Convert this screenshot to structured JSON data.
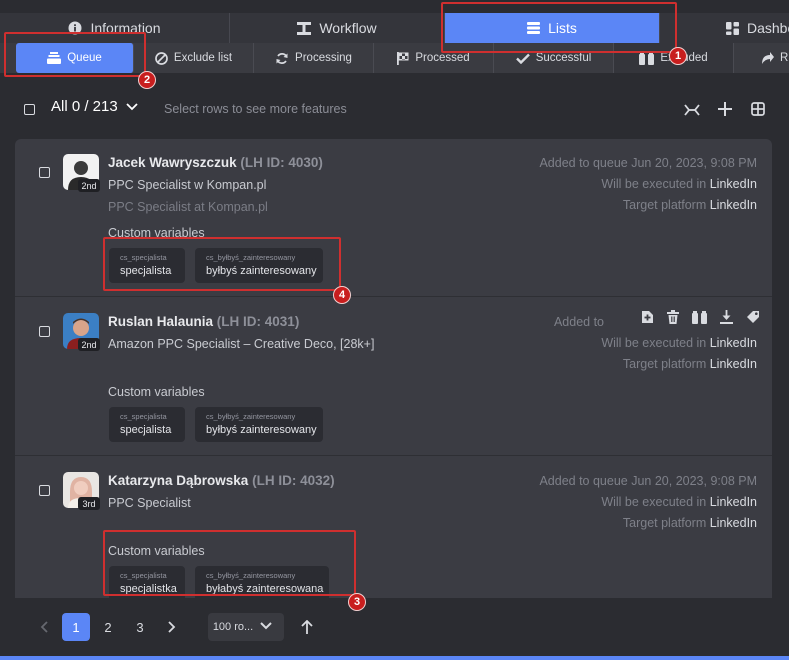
{
  "top_tabs": [
    {
      "label": "Information",
      "icon": "info-icon"
    },
    {
      "label": "Workflow",
      "icon": "workflow-icon"
    },
    {
      "label": "Lists",
      "icon": "list-icon",
      "active": true
    },
    {
      "label": "Dashbo",
      "icon": "dashboard-icon"
    }
  ],
  "sub_tabs": [
    {
      "label": "Queue",
      "icon": "queue-icon",
      "active": true
    },
    {
      "label": "Exclude list",
      "icon": "block-icon"
    },
    {
      "label": "Processing",
      "icon": "sync-icon"
    },
    {
      "label": "Processed",
      "icon": "flag-icon"
    },
    {
      "label": "Successful",
      "icon": "check-icon"
    },
    {
      "label": "Excluded",
      "icon": "exclude-icon"
    },
    {
      "label": "R",
      "icon": "reply-icon"
    }
  ],
  "toolbar": {
    "selection_label": "All 0 / 213",
    "hint": "Select rows to see more features"
  },
  "rows": [
    {
      "name": "Jacek Wawryszczuk",
      "lh_id": "(LH ID: 4030)",
      "degree": "2nd",
      "headline": "PPC Specialist w Kompan.pl",
      "company": "PPC Specialist at Kompan.pl",
      "added": "Added to queue Jun 20, 2023, 9:08 PM",
      "executed_prefix": "Will be executed in",
      "executed_platform": "LinkedIn",
      "target_prefix": "Target platform",
      "target_platform": "LinkedIn",
      "custom_title": "Custom variables",
      "vars": [
        {
          "key": "cs_specjalista",
          "value": "specjalista"
        },
        {
          "key": "cs_byłbyś_zainteresowany",
          "value": "byłbyś zainteresowany"
        }
      ]
    },
    {
      "name": "Ruslan Halaunia",
      "lh_id": "(LH ID: 4031)",
      "degree": "2nd",
      "headline": "Amazon PPC Specialist – Creative Deco, [28k+]",
      "company": "",
      "added": "Added to",
      "executed_prefix": "Will be executed in",
      "executed_platform": "LinkedIn",
      "target_prefix": "Target platform",
      "target_platform": "LinkedIn",
      "custom_title": "Custom variables",
      "vars": [
        {
          "key": "cs_specjalista",
          "value": "specjalista"
        },
        {
          "key": "cs_byłbyś_zainteresowany",
          "value": "byłbyś zainteresowany"
        }
      ]
    },
    {
      "name": "Katarzyna Dąbrowska",
      "lh_id": "(LH ID: 4032)",
      "degree": "3rd",
      "headline": "PPC Specialist",
      "company": "",
      "added": "Added to queue Jun 20, 2023, 9:08 PM",
      "executed_prefix": "Will be executed in",
      "executed_platform": "LinkedIn",
      "target_prefix": "Target platform",
      "target_platform": "LinkedIn",
      "custom_title": "Custom variables",
      "vars": [
        {
          "key": "cs_specjalista",
          "value": "specjalistka"
        },
        {
          "key": "cs_byłbyś_zainteresowany",
          "value": "byłabyś zainteresowana"
        }
      ]
    }
  ],
  "row_actions": [
    "add-icon",
    "trash-icon",
    "exclude-icon",
    "download-icon",
    "tag-icon"
  ],
  "pagination": {
    "pages": [
      "1",
      "2",
      "3"
    ],
    "current": "1",
    "rows_per_page": "100 ro..."
  },
  "annotations": [
    "1",
    "2",
    "3",
    "4"
  ],
  "colors": {
    "accent": "#5b86f6",
    "background": "#2b2c31",
    "panel": "#3b3c43",
    "annotation": "#cf2f2f"
  }
}
